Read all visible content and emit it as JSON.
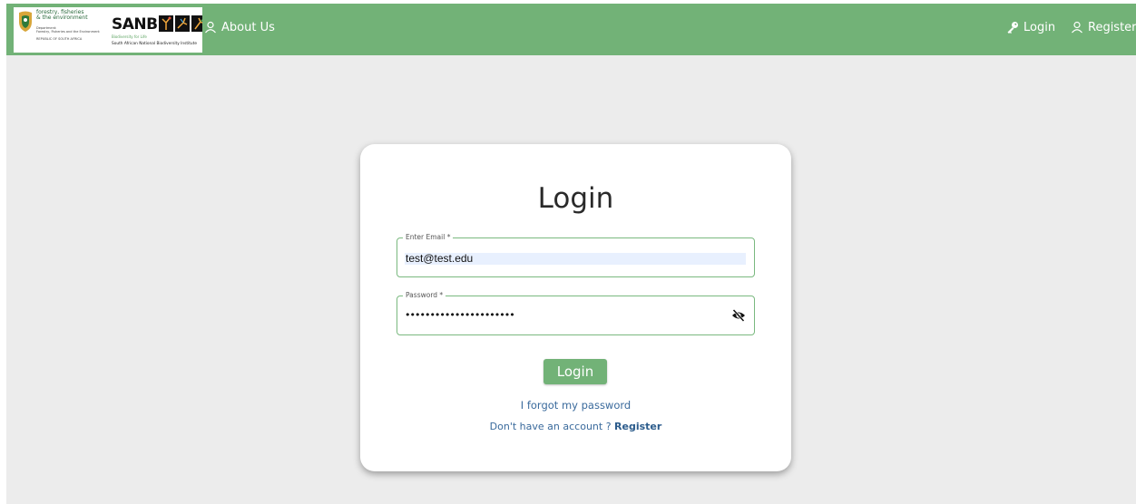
{
  "header": {
    "logo": {
      "dept_name": "forestry, fisheries\n& the environment",
      "dept_sub": "Department:\nForestry, Fisheries and the Environment",
      "dept_country": "REPUBLIC OF SOUTH AFRICA",
      "sanbi_name": "SANBI",
      "sanbi_tagline": "Biodiversity for Life",
      "sanbi_full_name": "South African National Biodiversity Institute"
    },
    "nav": {
      "about_label": "About Us",
      "login_label": "Login",
      "register_label": "Register"
    },
    "colors": {
      "header_bg": "#72b277"
    }
  },
  "login_card": {
    "title": "Login",
    "email": {
      "label": "Enter Email *",
      "value": "test@test.edu"
    },
    "password": {
      "label": "Password *",
      "masked_value": "••••••••••••••••••••••",
      "toggle_icon": "eye-off-icon"
    },
    "submit_label": "Login",
    "forgot_password_label": "I forgot my password",
    "no_account_text": "Don't have an account ?",
    "register_label": "Register"
  }
}
